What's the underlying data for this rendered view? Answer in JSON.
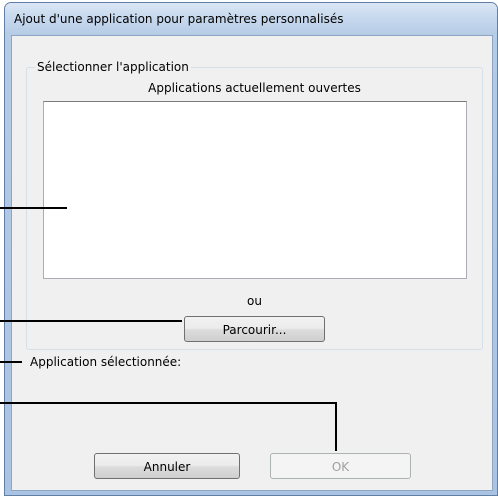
{
  "dialog": {
    "title": "Ajout d'une application pour paramètres personnalisés"
  },
  "select_group": {
    "title": "Sélectionner l'application",
    "list_header": "Applications actuellement ouvertes",
    "open_applications": [],
    "or_label": "ou",
    "browse_label": "Parcourir..."
  },
  "selected_application": {
    "label": "Application sélectionnée:",
    "value": ""
  },
  "buttons": {
    "cancel_label": "Annuler",
    "ok_label": "OK",
    "ok_enabled": false
  },
  "colors": {
    "window_frame": "#b4cbe6",
    "client_background": "#f0f0f0",
    "disabled_text": "#a0a0a0"
  }
}
